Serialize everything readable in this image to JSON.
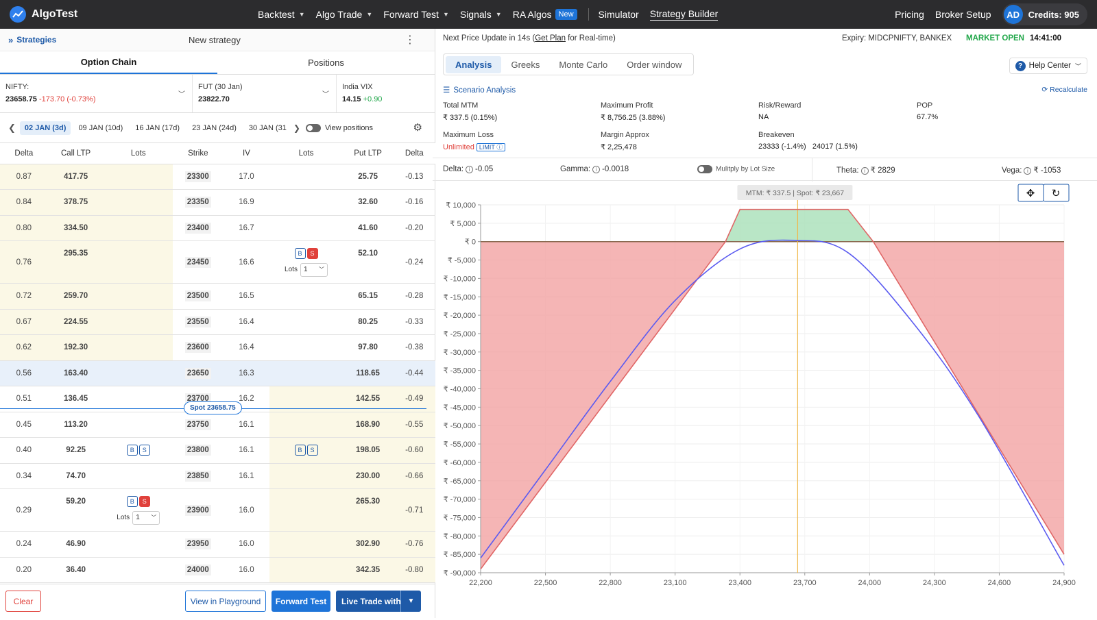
{
  "nav": {
    "brand": "AlgoTest",
    "items": [
      {
        "label": "Backtest",
        "dropdown": true
      },
      {
        "label": "Algo Trade",
        "dropdown": true
      },
      {
        "label": "Forward Test",
        "dropdown": true
      },
      {
        "label": "Signals",
        "dropdown": true
      }
    ],
    "ra_algos": "RA Algos",
    "new_badge": "New",
    "simulator": "Simulator",
    "strategy_builder": "Strategy Builder",
    "pricing": "Pricing",
    "broker_setup": "Broker Setup",
    "avatar": "AD",
    "credits": "Credits: 905"
  },
  "left": {
    "strategies_link": "Strategies",
    "title": "New strategy",
    "tabs": [
      "Option Chain",
      "Positions"
    ],
    "quotes": [
      {
        "label": "NIFTY:",
        "value": "23658.75",
        "change": "-173.70 (-0.73%)"
      },
      {
        "label": "FUT (30 Jan)",
        "value": "23822.70",
        "change": ""
      },
      {
        "label": "India VIX",
        "value": "14.15",
        "change": "+0.90"
      }
    ],
    "expiries": [
      "02 JAN (3d)",
      "09 JAN (10d)",
      "16 JAN (17d)",
      "23 JAN (24d)",
      "30 JAN (31"
    ],
    "view_positions": "View positions",
    "columns": [
      "Delta",
      "Call LTP",
      "Lots",
      "Strike",
      "IV",
      "Lots",
      "Put LTP",
      "Delta"
    ],
    "rows": [
      {
        "cdelta": "0.87",
        "call": "417.75",
        "strike": "23300",
        "iv": "17.0",
        "put": "25.75",
        "pdelta": "-0.13"
      },
      {
        "cdelta": "0.84",
        "call": "378.75",
        "strike": "23350",
        "iv": "16.9",
        "put": "32.60",
        "pdelta": "-0.16"
      },
      {
        "cdelta": "0.80",
        "call": "334.50",
        "strike": "23400",
        "iv": "16.7",
        "put": "41.60",
        "pdelta": "-0.20"
      },
      {
        "cdelta": "0.76",
        "call": "295.35",
        "strike": "23450",
        "iv": "16.6",
        "put": "52.10",
        "pdelta": "-0.24"
      },
      {
        "cdelta": "0.72",
        "call": "259.70",
        "strike": "23500",
        "iv": "16.5",
        "put": "65.15",
        "pdelta": "-0.28"
      },
      {
        "cdelta": "0.67",
        "call": "224.55",
        "strike": "23550",
        "iv": "16.4",
        "put": "80.25",
        "pdelta": "-0.33"
      },
      {
        "cdelta": "0.62",
        "call": "192.30",
        "strike": "23600",
        "iv": "16.4",
        "put": "97.80",
        "pdelta": "-0.38"
      },
      {
        "cdelta": "0.56",
        "call": "163.40",
        "strike": "23650",
        "iv": "16.3",
        "put": "118.65",
        "pdelta": "-0.44"
      },
      {
        "cdelta": "0.51",
        "call": "136.45",
        "strike": "23700",
        "iv": "16.2",
        "put": "142.55",
        "pdelta": "-0.49"
      },
      {
        "cdelta": "0.45",
        "call": "113.20",
        "strike": "23750",
        "iv": "16.1",
        "put": "168.90",
        "pdelta": "-0.55"
      },
      {
        "cdelta": "0.40",
        "call": "92.25",
        "strike": "23800",
        "iv": "16.1",
        "put": "198.05",
        "pdelta": "-0.60"
      },
      {
        "cdelta": "0.34",
        "call": "74.70",
        "strike": "23850",
        "iv": "16.1",
        "put": "230.00",
        "pdelta": "-0.66"
      },
      {
        "cdelta": "0.29",
        "call": "59.20",
        "strike": "23900",
        "iv": "16.0",
        "put": "265.30",
        "pdelta": "-0.71"
      },
      {
        "cdelta": "0.24",
        "call": "46.90",
        "strike": "23950",
        "iv": "16.0",
        "put": "302.90",
        "pdelta": "-0.76"
      },
      {
        "cdelta": "0.20",
        "call": "36.40",
        "strike": "24000",
        "iv": "16.0",
        "put": "342.35",
        "pdelta": "-0.80"
      }
    ],
    "b": "B",
    "s": "S",
    "lots_label": "Lots",
    "lots_value": "1",
    "spot_pill": "Spot 23658.75",
    "buttons": {
      "clear": "Clear",
      "playground": "View in Playground",
      "forward": "Forward Test",
      "live": "Live Trade with"
    }
  },
  "right": {
    "update_prefix": "Next Price Update in 14s (",
    "get_plan": "Get Plan",
    "update_suffix": " for Real-time)",
    "expiry": "Expiry:  MIDCPNIFTY, BANKEX",
    "market": "MARKET OPEN",
    "clock": "14:41:00",
    "tabs": [
      "Analysis",
      "Greeks",
      "Monte Carlo",
      "Order window"
    ],
    "help": "Help Center",
    "scenario": "Scenario Analysis",
    "recalc": "Recalculate",
    "stats": {
      "total_mtm_label": "Total MTM",
      "total_mtm": "₹ 337.5 (0.15%)",
      "max_profit_label": "Maximum Profit",
      "max_profit": "₹ 8,756.25 (3.88%)",
      "rr_label": "Risk/Reward",
      "rr": "NA",
      "pop_label": "POP",
      "pop": "67.7%",
      "max_loss_label": "Maximum Loss",
      "max_loss": "Unlimited",
      "limit": "LIMIT",
      "margin_label": "Margin Approx",
      "margin": "₹ 2,25,478",
      "breakeven_label": "Breakeven",
      "breakeven": "23333 (-1.4%)   24017 (1.5%)"
    },
    "greeks": {
      "delta_label": "Delta:",
      "delta": "-0.05",
      "gamma_label": "Gamma:",
      "gamma": "-0.0018",
      "multiply": "Mulitply by Lot Size",
      "theta_label": "Theta:",
      "theta": "₹ 2829",
      "vega_label": "Vega:",
      "vega": "₹ -1053"
    },
    "tooltip": "MTM: ₹ 337.5   |   Spot: ₹ 23,667"
  },
  "chart_data": {
    "type": "line",
    "x_ticks": [
      "22,200",
      "22,500",
      "22,800",
      "23,100",
      "23,400",
      "23,700",
      "24,000",
      "24,300",
      "24,600",
      "24,900"
    ],
    "y_ticks": [
      "₹ 10,000",
      "₹ 5,000",
      "₹ 0",
      "₹ -5,000",
      "₹ -10,000",
      "₹ -15,000",
      "₹ -20,000",
      "₹ -25,000",
      "₹ -30,000",
      "₹ -35,000",
      "₹ -40,000",
      "₹ -45,000",
      "₹ -50,000",
      "₹ -55,000",
      "₹ -60,000",
      "₹ -65,000",
      "₹ -70,000",
      "₹ -75,000",
      "₹ -80,000",
      "₹ -85,000",
      "₹ -90,000"
    ],
    "xlim": [
      22200,
      24900
    ],
    "ylim": [
      -90000,
      10000
    ],
    "series": [
      {
        "name": "",
        "color": "#e06666",
        "x": [
          22200,
          23333,
          23400,
          23900,
          24017,
          24900
        ],
        "y": [
          -89000,
          0,
          8756,
          8756,
          0,
          -85000
        ]
      },
      {
        "name": "",
        "color": "#5b5bf0",
        "x": [
          22200,
          22500,
          22800,
          23100,
          23400,
          23658,
          23900,
          24200,
          24500,
          24900
        ],
        "y": [
          -86000,
          -62000,
          -38000,
          -16000,
          -2000,
          337,
          -3000,
          -22000,
          -47000,
          -88000
        ]
      }
    ],
    "spot": 23667,
    "colors": {
      "profit": "#a8e0b8",
      "loss": "#f3a3a3"
    }
  }
}
